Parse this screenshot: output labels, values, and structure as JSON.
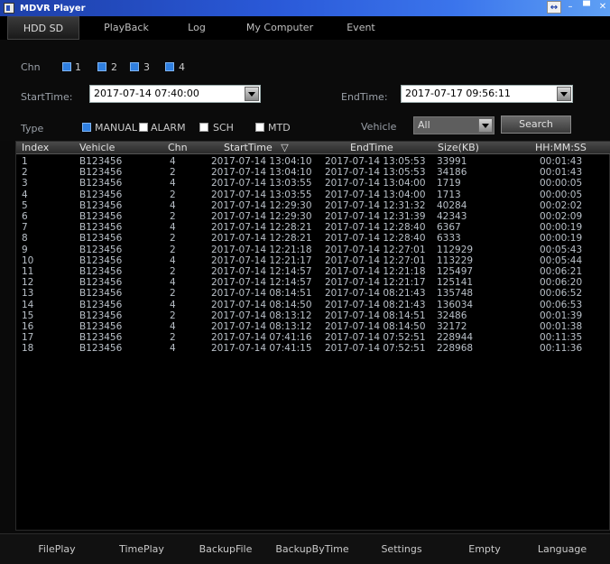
{
  "window": {
    "title": "MDVR Player"
  },
  "menu": {
    "items": [
      {
        "label": "HDD SD",
        "active": true
      },
      {
        "label": "PlayBack"
      },
      {
        "label": "Log"
      },
      {
        "label": "My Computer"
      },
      {
        "label": "Event"
      }
    ]
  },
  "filters": {
    "chn_label": "Chn",
    "channels": [
      "1",
      "2",
      "3",
      "4"
    ],
    "start_label": "StartTime:",
    "start_value": "2017-07-14 07:40:00",
    "end_label": "EndTime:",
    "end_value": "2017-07-17 09:56:11",
    "type_label": "Type",
    "types": [
      "MANUAL",
      "ALARM",
      "SCH",
      "MTD"
    ],
    "vehicle_label": "Vehicle",
    "vehicle_value": "All",
    "search_label": "Search"
  },
  "table": {
    "columns": [
      "Index",
      "Vehicle",
      "Chn",
      "StartTime",
      "EndTime",
      "Size(KB)",
      "HH:MM:SS"
    ],
    "sort_indicator": "▽",
    "rows": [
      [
        "1",
        "B123456",
        "4",
        "2017-07-14 13:04:10",
        "2017-07-14 13:05:53",
        "33991",
        "00:01:43"
      ],
      [
        "2",
        "B123456",
        "2",
        "2017-07-14 13:04:10",
        "2017-07-14 13:05:53",
        "34186",
        "00:01:43"
      ],
      [
        "3",
        "B123456",
        "4",
        "2017-07-14 13:03:55",
        "2017-07-14 13:04:00",
        "1719",
        "00:00:05"
      ],
      [
        "4",
        "B123456",
        "2",
        "2017-07-14 13:03:55",
        "2017-07-14 13:04:00",
        "1713",
        "00:00:05"
      ],
      [
        "5",
        "B123456",
        "4",
        "2017-07-14 12:29:30",
        "2017-07-14 12:31:32",
        "40284",
        "00:02:02"
      ],
      [
        "6",
        "B123456",
        "2",
        "2017-07-14 12:29:30",
        "2017-07-14 12:31:39",
        "42343",
        "00:02:09"
      ],
      [
        "7",
        "B123456",
        "4",
        "2017-07-14 12:28:21",
        "2017-07-14 12:28:40",
        "6367",
        "00:00:19"
      ],
      [
        "8",
        "B123456",
        "2",
        "2017-07-14 12:28:21",
        "2017-07-14 12:28:40",
        "6333",
        "00:00:19"
      ],
      [
        "9",
        "B123456",
        "2",
        "2017-07-14 12:21:18",
        "2017-07-14 12:27:01",
        "112929",
        "00:05:43"
      ],
      [
        "10",
        "B123456",
        "4",
        "2017-07-14 12:21:17",
        "2017-07-14 12:27:01",
        "113229",
        "00:05:44"
      ],
      [
        "11",
        "B123456",
        "2",
        "2017-07-14 12:14:57",
        "2017-07-14 12:21:18",
        "125497",
        "00:06:21"
      ],
      [
        "12",
        "B123456",
        "4",
        "2017-07-14 12:14:57",
        "2017-07-14 12:21:17",
        "125141",
        "00:06:20"
      ],
      [
        "13",
        "B123456",
        "2",
        "2017-07-14 08:14:51",
        "2017-07-14 08:21:43",
        "135748",
        "00:06:52"
      ],
      [
        "14",
        "B123456",
        "4",
        "2017-07-14 08:14:50",
        "2017-07-14 08:21:43",
        "136034",
        "00:06:53"
      ],
      [
        "15",
        "B123456",
        "2",
        "2017-07-14 08:13:12",
        "2017-07-14 08:14:51",
        "32486",
        "00:01:39"
      ],
      [
        "16",
        "B123456",
        "4",
        "2017-07-14 08:13:12",
        "2017-07-14 08:14:50",
        "32172",
        "00:01:38"
      ],
      [
        "17",
        "B123456",
        "2",
        "2017-07-14 07:41:16",
        "2017-07-14 07:52:51",
        "228944",
        "00:11:35"
      ],
      [
        "18",
        "B123456",
        "4",
        "2017-07-14 07:41:15",
        "2017-07-14 07:52:51",
        "228968",
        "00:11:36"
      ]
    ]
  },
  "bottom": {
    "buttons": [
      "FilePlay",
      "TimePlay",
      "BackupFile",
      "BackupByTime",
      "Settings",
      "Empty",
      "Language"
    ]
  },
  "colors": {
    "titlebar": "#2a59d8",
    "checkbox": "#2f7fe0",
    "background": "#0a0a0a"
  }
}
